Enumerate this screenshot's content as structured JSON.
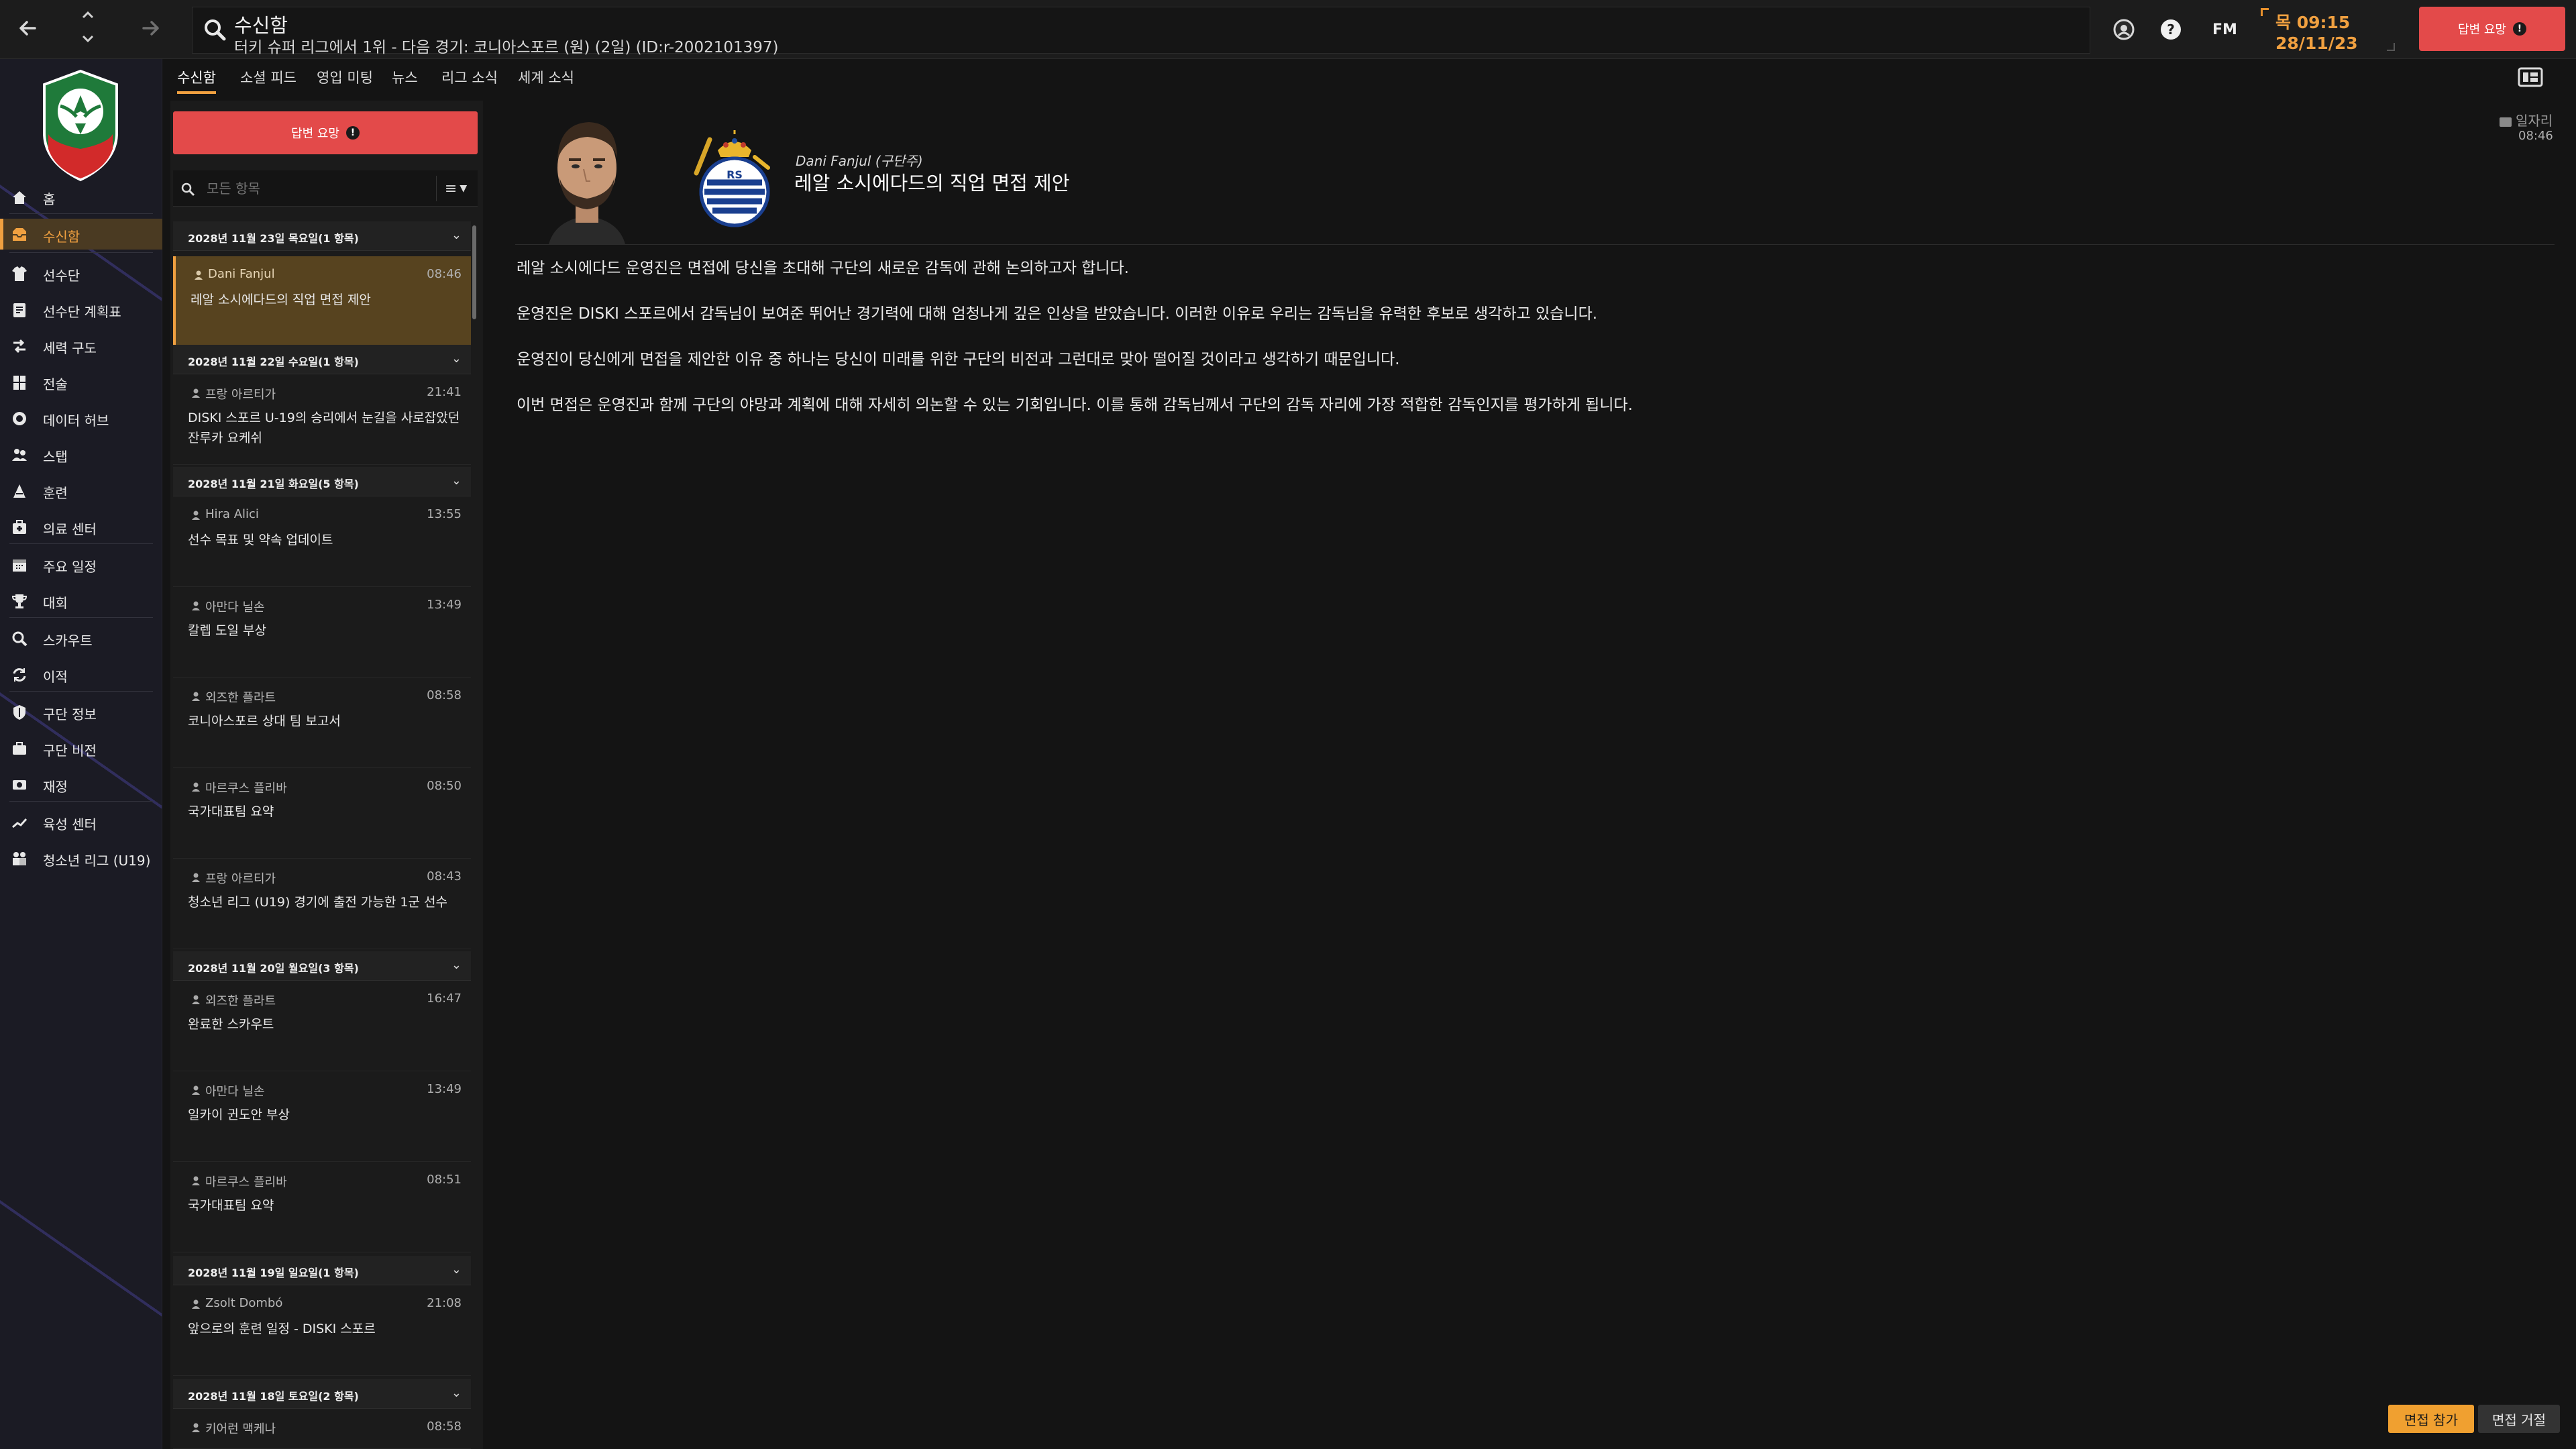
{
  "header": {
    "title": "수신함",
    "subtitle": "터키 슈퍼 리그에서 1위 - 다음 경기: 코니아스포르 (원) (2일) (ID:r-2002101397)",
    "fm_logo": "FM",
    "time": "목 09:15",
    "date": "28/11/23",
    "alert_button": "답변 요망"
  },
  "sidebar": {
    "items": [
      {
        "label": "홈",
        "icon": "home-icon"
      },
      {
        "label": "수신함",
        "icon": "inbox-icon",
        "active": true
      },
      {
        "label": "선수단",
        "icon": "squad-icon"
      },
      {
        "label": "선수단 계획표",
        "icon": "squad-planner-icon"
      },
      {
        "label": "세력 구도",
        "icon": "dynamics-icon"
      },
      {
        "label": "전술",
        "icon": "tactics-icon"
      },
      {
        "label": "데이터 허브",
        "icon": "data-hub-icon"
      },
      {
        "label": "스탭",
        "icon": "staff-icon"
      },
      {
        "label": "훈련",
        "icon": "training-icon"
      },
      {
        "label": "의료 센터",
        "icon": "medical-icon"
      },
      {
        "label": "주요 일정",
        "icon": "schedule-icon"
      },
      {
        "label": "대회",
        "icon": "trophy-icon"
      },
      {
        "label": "스카우트",
        "icon": "scout-icon"
      },
      {
        "label": "이적",
        "icon": "transfer-icon"
      },
      {
        "label": "구단 정보",
        "icon": "club-info-icon"
      },
      {
        "label": "구단 비전",
        "icon": "club-vision-icon"
      },
      {
        "label": "재정",
        "icon": "finance-icon"
      },
      {
        "label": "육성 센터",
        "icon": "development-icon"
      },
      {
        "label": "청소년 리그 (U19)",
        "icon": "youth-icon"
      }
    ]
  },
  "tabs": [
    "수신함",
    "소셜 피드",
    "영입 미팅",
    "뉴스",
    "리그 소식",
    "세계 소식"
  ],
  "list": {
    "reply_button": "답변 요망",
    "filter_placeholder": "모든 항목",
    "filter_menu": "≡",
    "groups": [
      {
        "header": "2028년 11월 23일 목요일(1 항목)",
        "messages": [
          {
            "sender": "Dani Fanjul",
            "time": "08:46",
            "subject": "레알 소시에다드의 직업 면접 제안",
            "selected": true
          }
        ]
      },
      {
        "header": "2028년 11월 22일 수요일(1 항목)",
        "messages": [
          {
            "sender": "프랑 아르티가",
            "time": "21:41",
            "subject": "DISKI 스포르 U-19의 승리에서 눈길을 사로잡았던 잔루카 요케쉬"
          }
        ]
      },
      {
        "header": "2028년 11월 21일 화요일(5 항목)",
        "messages": [
          {
            "sender": "Hira Alici",
            "time": "13:55",
            "subject": "선수 목표 및 약속 업데이트"
          },
          {
            "sender": "아만다 닐손",
            "time": "13:49",
            "subject": "칼렙 도일 부상"
          },
          {
            "sender": "외즈한 플라트",
            "time": "08:58",
            "subject": "코니아스포르 상대 팀 보고서"
          },
          {
            "sender": "마르쿠스 플리바",
            "time": "08:50",
            "subject": "국가대표팀 요약"
          },
          {
            "sender": "프랑 아르티가",
            "time": "08:43",
            "subject": "청소년 리그 (U19) 경기에 출전 가능한 1군 선수"
          }
        ]
      },
      {
        "header": "2028년 11월 20일 월요일(3 항목)",
        "messages": [
          {
            "sender": "외즈한 플라트",
            "time": "16:47",
            "subject": "완료한 스카우트"
          },
          {
            "sender": "아만다 닐손",
            "time": "13:49",
            "subject": "일카이 귄도안 부상"
          },
          {
            "sender": "마르쿠스 플리바",
            "time": "08:51",
            "subject": "국가대표팀 요약"
          }
        ]
      },
      {
        "header": "2028년 11월 19일 일요일(1 항목)",
        "messages": [
          {
            "sender": "Zsolt Dombó",
            "time": "21:08",
            "subject": "앞으로의 훈련 일정 - DISKI 스포르"
          }
        ]
      },
      {
        "header": "2028년 11월 18일 토요일(2 항목)",
        "messages": [
          {
            "sender": "키어런 맥케나",
            "time": "08:58",
            "subject": ""
          }
        ]
      }
    ]
  },
  "detail": {
    "from": "Dani Fanjul (구단주)",
    "title": "레알 소시에다드의 직업 면접 제안",
    "inbox_tag": "일자리",
    "time": "08:46",
    "paragraphs": [
      "레알 소시에다드 운영진은 면접에 당신을 초대해 구단의 새로운 감독에 관해 논의하고자 합니다.",
      "운영진은 DISKI 스포르에서 감독님이 보여준 뛰어난 경기력에 대해 엄청나게 깊은 인상을 받았습니다. 이러한 이유로 우리는 감독님을 유력한 후보로 생각하고 있습니다.",
      "운영진이 당신에게 면접을 제안한 이유 중 하나는 당신이 미래를 위한 구단의 비전과 그런대로 맞아 떨어질 것이라고 생각하기 때문입니다.",
      "이번 면접은 운영진과 함께 구단의 야망과 계획에 대해 자세히 의논할 수 있는 기회입니다. 이를 통해 감독님께서 구단의 감독 자리에 가장 적합한 감독인지를 평가하게 됩니다."
    ],
    "accept_button": "면접 참가",
    "decline_button": "면접 거절"
  },
  "colors": {
    "accent": "#f0a040",
    "alert": "#e34a4a",
    "background": "#141414",
    "selected_row": "#57431f"
  }
}
